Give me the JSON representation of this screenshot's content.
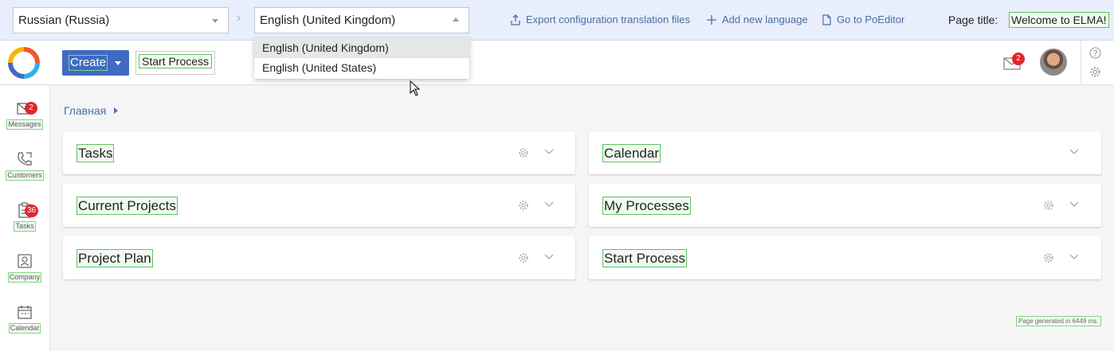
{
  "translation_bar": {
    "source_language": "Russian (Russia)",
    "target_language": "English (United Kingdom)",
    "export_link": "Export configuration translation files",
    "add_language_link": "Add new language",
    "poeditor_link": "Go to PoEditor",
    "page_title_label": "Page title:",
    "page_title_value": "Welcome to ELMA!"
  },
  "language_dropdown": {
    "options": [
      "English (United Kingdom)",
      "English (United States)"
    ],
    "selected": "English (United Kingdom)"
  },
  "header": {
    "create_label": "Create",
    "start_process_label": "Start Process",
    "messages_badge": "2"
  },
  "sidebar": {
    "items": [
      {
        "label": "Messages",
        "badge": "2",
        "icon": "mail-icon"
      },
      {
        "label": "Customers",
        "badge": "",
        "icon": "phone-icon"
      },
      {
        "label": "Tasks",
        "badge": "36",
        "icon": "clipboard-icon"
      },
      {
        "label": "Company",
        "badge": "",
        "icon": "company-icon"
      },
      {
        "label": "Calendar",
        "badge": "",
        "icon": "calendar-icon"
      }
    ]
  },
  "breadcrumb": {
    "home": "Главная"
  },
  "cards": {
    "tasks": "Tasks",
    "calendar": "Calendar",
    "current_projects": "Current Projects",
    "my_processes": "My Processes",
    "project_plan": "Project Plan",
    "start_process": "Start Process"
  },
  "footer": {
    "generated": "Page generated in 6449 ms."
  },
  "colors": {
    "primary": "#3f6bc4",
    "link": "#4a6fa5",
    "badge": "#e3242b",
    "toolbar_bg": "#e8eefb",
    "highlight_border": "#5cc45c"
  }
}
